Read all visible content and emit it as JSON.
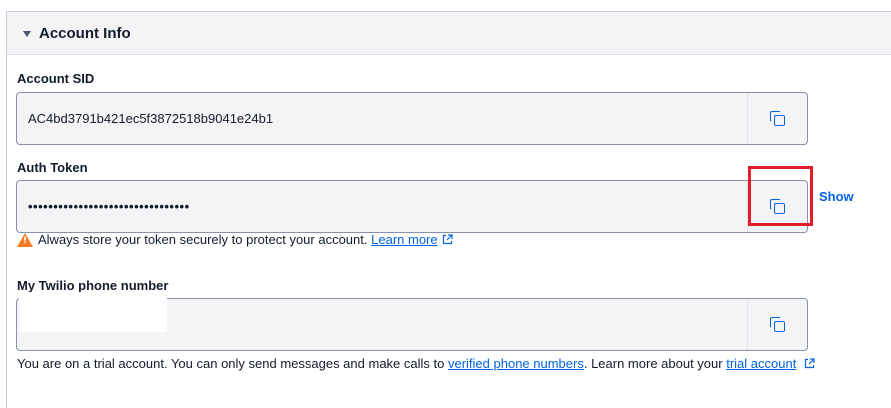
{
  "section": {
    "title": "Account Info"
  },
  "account_sid": {
    "label": "Account SID",
    "value": "AC4bd3791b421ec5f3872518b9041e24b1"
  },
  "auth_token": {
    "label": "Auth Token",
    "masked_value": "••••••••••••••••••••••••••••••••",
    "show_label": "Show",
    "warning_text": "Always store your token securely to protect your account.",
    "learn_more_label": "Learn more"
  },
  "phone_number": {
    "label": "My Twilio phone number",
    "value": ""
  },
  "footer": {
    "text_1": "You are on a trial account. You can only send messages and make calls to",
    "verified_link": "verified phone numbers",
    "text_2": ". Learn more about your",
    "trial_link": "trial account"
  },
  "colors": {
    "link": "#0263e0",
    "warning": "#f47c22",
    "highlight": "#e11d2a",
    "field_bg": "#f4f4f6"
  }
}
